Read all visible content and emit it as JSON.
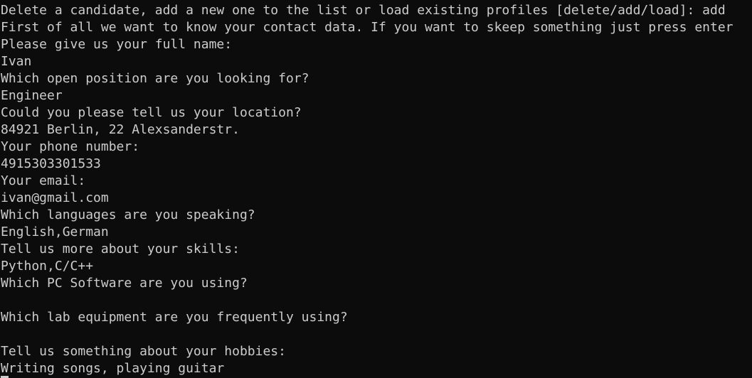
{
  "terminal": {
    "lines": [
      "Delete a candidate, add a new one to the list or load existing profiles [delete/add/load]: add",
      "First of all we want to know your contact data. If you want to skeep something just press enter",
      "Please give us your full name:",
      "Ivan",
      "Which open position are you looking for?",
      "Engineer",
      "Could you please tell us your location?",
      "84921 Berlin, 22 Alexsanderstr.",
      "Your phone number:",
      "4915303301533",
      "Your email:",
      "ivan@gmail.com",
      "Which languages are you speaking?",
      "English,German",
      "Tell us more about your skills:",
      "Python,C/C++",
      "Which PC Software are you using?",
      "",
      "Which lab equipment are you frequently using?",
      "",
      "Tell us something about your hobbies:",
      "Writing songs, playing guitar"
    ]
  }
}
